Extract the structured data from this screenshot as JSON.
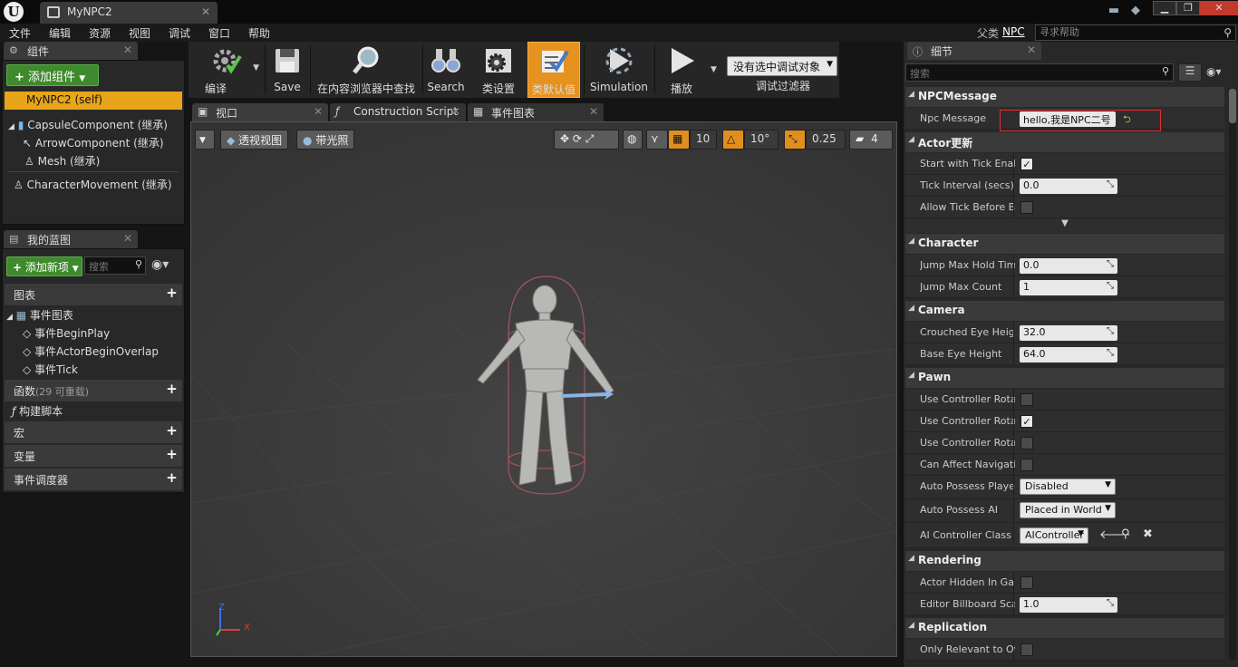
{
  "app": {
    "doc_tab": "MyNPC2",
    "menu": [
      "文件",
      "编辑",
      "资源",
      "视图",
      "调试",
      "窗口",
      "帮助"
    ],
    "parent_label": "父类",
    "parent_link": "NPC",
    "help_search_placeholder": "寻求帮助"
  },
  "components_panel": {
    "tab": "组件",
    "add_button": "添加组件",
    "items": [
      "MyNPC2 (self)",
      "CapsuleComponent (继承)",
      "ArrowComponent (继承)",
      "Mesh (继承)",
      "CharacterMovement (继承)"
    ]
  },
  "blueprint_panel": {
    "tab": "我的蓝图",
    "add_button": "添加新项",
    "search_placeholder": "搜索",
    "graph_header": "图表",
    "event_graph": "事件图表",
    "events": [
      "事件BeginPlay",
      "事件ActorBeginOverlap",
      "事件Tick"
    ],
    "functions_header": "函数",
    "functions_sub": "(29 可重载)",
    "construction_script": "构建脚本",
    "macros": "宏",
    "variables": "变量",
    "dispatchers": "事件调度器"
  },
  "toolbar": {
    "compile": "编译",
    "save": "Save",
    "browse": "在内容浏览器中查找",
    "search": "Search",
    "class_settings": "类设置",
    "class_defaults": "类默认值",
    "simulation": "Simulation",
    "play": "播放",
    "debug_object": "没有选中调试对象",
    "debug_filter": "调试过滤器"
  },
  "editor_tabs": {
    "viewport": "视口",
    "construction_script": "Construction Script",
    "event_graph": "事件图表"
  },
  "viewport": {
    "perspective": "透视视图",
    "lit": "带光照",
    "grid_snap": "10",
    "rot_snap": "10°",
    "scale_snap": "0.25",
    "camera_speed": "4",
    "axis_x": "X",
    "axis_z": "Z"
  },
  "details": {
    "tab": "细节",
    "search_placeholder": "搜索",
    "sections": {
      "npc": "NPCMessage",
      "actor": "Actor更新",
      "character": "Character",
      "camera": "Camera",
      "pawn": "Pawn",
      "rendering": "Rendering",
      "replication": "Replication"
    },
    "npc_message_label": "Npc Message",
    "npc_message_value": "hello,我是NPC二号",
    "start_tick_label": "Start with Tick Enabl",
    "tick_interval_label": "Tick Interval (secs)",
    "tick_interval_value": "0.0",
    "allow_tick_label": "Allow Tick Before Be",
    "jump_hold_label": "Jump Max Hold Time",
    "jump_hold_value": "0.0",
    "jump_count_label": "Jump Max Count",
    "jump_count_value": "1",
    "crouched_eye_label": "Crouched Eye Height",
    "crouched_eye_value": "32.0",
    "base_eye_label": "Base Eye Height",
    "base_eye_value": "64.0",
    "ucr1_label": "Use Controller Rotati",
    "ucr2_label": "Use Controller Rotati",
    "ucr3_label": "Use Controller Rotati",
    "affect_nav_label": "Can Affect Navigatio",
    "auto_possess_player_label": "Auto Possess Player",
    "auto_possess_player_value": "Disabled",
    "auto_possess_ai_label": "Auto Possess AI",
    "auto_possess_ai_value": "Placed in World",
    "ai_controller_label": "AI Controller Class",
    "ai_controller_value": "AIController",
    "hidden_label": "Actor Hidden In Gam",
    "billboard_label": "Editor Billboard Scal",
    "billboard_value": "1.0",
    "only_relevant_label": "Only Relevant to Ow"
  },
  "colors": {
    "accent_orange": "#e6921e",
    "add_green": "#3e8a2c",
    "panel_bg": "#282828",
    "viewport_bg": "#3c3c3c"
  }
}
